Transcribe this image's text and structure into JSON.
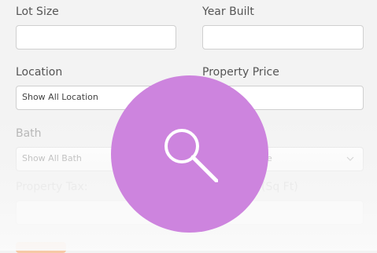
{
  "form": {
    "lot_size_label": "Lot Size",
    "year_built_label": "Year Built",
    "location_label": "Location",
    "location_value": "Show All Location",
    "property_price_label": "Property Price",
    "bath_label": "Bath",
    "bath_value": "Show All Bath",
    "right_select_fragment": "e",
    "property_tax_label": "Property Tax:",
    "area_label_fragment": "(Sq Ft)"
  },
  "overlay": {
    "search_icon": "search-icon",
    "circle_color": "#cd84de"
  }
}
